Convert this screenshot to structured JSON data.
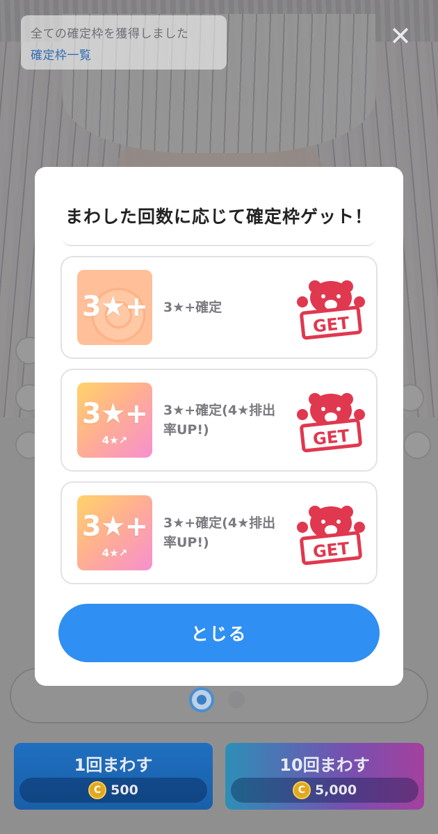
{
  "notice": {
    "text": "全ての確定枠を獲得しました",
    "link": "確定枠一覧"
  },
  "close_glyph": "✕",
  "modal": {
    "title": "まわした回数に応じて確定枠ゲット！",
    "items": [
      {
        "badge": "3★+",
        "badge_sub": "",
        "label": "3★+確定",
        "stamp": "GET"
      },
      {
        "badge": "3★+",
        "badge_sub": "4★↗",
        "label": "3★+確定(4★排出率UP!)",
        "stamp": "GET"
      },
      {
        "badge": "3★+",
        "badge_sub": "4★↗",
        "label": "3★+確定(4★排出率UP!)",
        "stamp": "GET"
      }
    ],
    "close_label": "とじる"
  },
  "spin": {
    "single": {
      "label": "1回まわす",
      "cost": "500",
      "coin": "C"
    },
    "ten": {
      "label": "10回まわす",
      "cost": "5,000",
      "coin": "C"
    }
  },
  "colors": {
    "primary_button": "#2f8ff2",
    "stamp": "#e0384f",
    "link": "#2f6fb4"
  }
}
